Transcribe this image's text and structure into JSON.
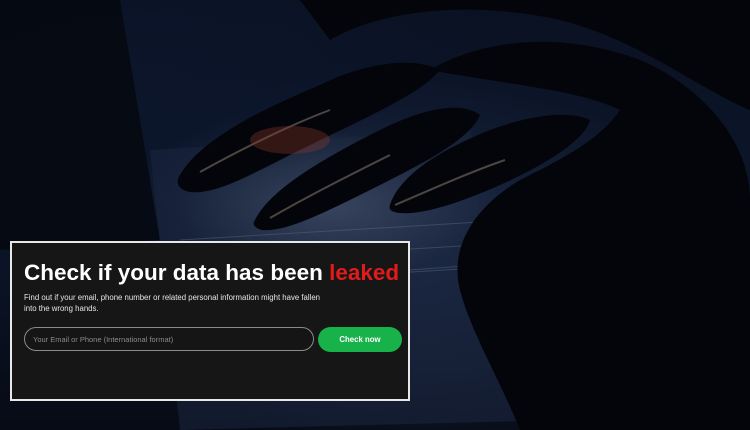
{
  "hero": {
    "image_description_icon": "hacker-hand-keyboard-photo"
  },
  "panel": {
    "title_main": "Check if your data has been ",
    "title_highlight": "leaked",
    "description": "Find out if your email, phone number or related personal information might have fallen into the wrong hands.",
    "input_value": "",
    "input_placeholder": "Your Email or Phone (International format)",
    "button_label": "Check now"
  },
  "colors": {
    "highlight": "#e01b1b",
    "button": "#17b24a",
    "panel_bg": "#161616",
    "panel_border": "#e8e8e8"
  }
}
